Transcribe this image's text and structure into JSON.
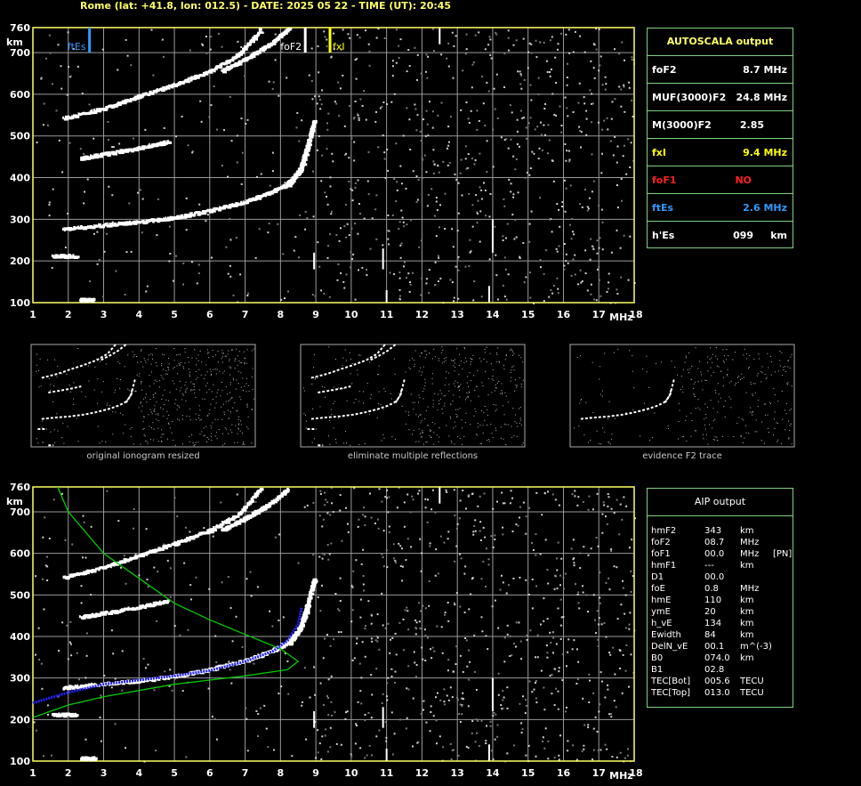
{
  "header": "Rome (lat: +41.8, lon: 012.5) - DATE: 2025 05 22 - TIME (UT): 20:45",
  "colors": {
    "grid": "#9a9a9a",
    "frame": "#ffff66",
    "box": "#7fd07f",
    "ftEs": "#3399ff",
    "foF2": "#ffffff",
    "fxI": "#ffff00",
    "noColor": "#ff2020",
    "trace": "#ffffff",
    "model": "#00cc00",
    "profile": "#2222ff"
  },
  "chart_data": [
    {
      "type": "scatter",
      "name_in_ui": "autoscala-ionogram",
      "x_min": 1,
      "x_max": 18,
      "y_min": 100,
      "y_max": 760,
      "xticks": [
        "1",
        "2",
        "3",
        "4",
        "5",
        "6",
        "7",
        "8",
        "9",
        "10",
        "11",
        "12",
        "13",
        "14",
        "15",
        "16",
        "17",
        "18"
      ],
      "yticks": [
        "100",
        "200",
        "300",
        "400",
        "500",
        "600",
        "700",
        "760"
      ],
      "xunit": "MHz",
      "yunit": "km",
      "markers": [
        {
          "label": "ftEs",
          "freq": 2.6,
          "color": "#3399ff"
        },
        {
          "label": "foF2",
          "freq": 8.7,
          "color": "#ffffff"
        },
        {
          "label": "fxI",
          "freq": 9.4,
          "color": "#ffff00"
        }
      ],
      "traces": [
        {
          "points": [
            [
              1.8,
              280
            ],
            [
              3,
              290
            ],
            [
              4,
              297
            ],
            [
              5,
              308
            ],
            [
              6,
              325
            ],
            [
              7,
              347
            ],
            [
              7.6,
              365
            ],
            [
              8.1,
              385
            ],
            [
              8.5,
              420
            ],
            [
              8.7,
              480
            ]
          ]
        },
        {
          "points": [
            [
              8.2,
              385
            ],
            [
              8.6,
              440
            ],
            [
              8.8,
              510
            ],
            [
              8.9,
              540
            ]
          ]
        },
        {
          "points": [
            [
              1.8,
              545
            ],
            [
              3,
              570
            ],
            [
              4,
              600
            ],
            [
              5,
              628
            ],
            [
              6,
              660
            ],
            [
              6.8,
              700
            ],
            [
              7.4,
              760
            ]
          ]
        },
        {
          "points": [
            [
              6.3,
              660
            ],
            [
              7,
              690
            ],
            [
              7.6,
              720
            ],
            [
              8.2,
              760
            ]
          ]
        },
        {
          "points": [
            [
              2.3,
              450
            ],
            [
              3,
              460
            ],
            [
              4,
              475
            ],
            [
              4.8,
              490
            ]
          ]
        },
        {
          "points": [
            [
              2.3,
              110
            ],
            [
              2.7,
              110
            ]
          ]
        },
        {
          "points": [
            [
              1.5,
              215
            ],
            [
              2.2,
              215
            ]
          ]
        }
      ]
    },
    {
      "type": "scatter",
      "name_in_ui": "aip-ionogram",
      "x_min": 1,
      "x_max": 18,
      "y_min": 100,
      "y_max": 760,
      "xticks": [
        "1",
        "2",
        "3",
        "4",
        "5",
        "6",
        "7",
        "8",
        "9",
        "10",
        "11",
        "12",
        "13",
        "14",
        "15",
        "16",
        "17",
        "18"
      ],
      "yticks": [
        "100",
        "200",
        "300",
        "400",
        "500",
        "600",
        "700",
        "760"
      ],
      "xunit": "MHz",
      "yunit": "km",
      "model_curve": [
        [
          1.7,
          760
        ],
        [
          2,
          700
        ],
        [
          3,
          600
        ],
        [
          4,
          540
        ],
        [
          5,
          480
        ],
        [
          6,
          440
        ],
        [
          7,
          405
        ],
        [
          8,
          370
        ],
        [
          8.5,
          340
        ],
        [
          8.2,
          320
        ],
        [
          7,
          305
        ],
        [
          6,
          295
        ],
        [
          5,
          285
        ],
        [
          4,
          270
        ],
        [
          3,
          255
        ],
        [
          2,
          235
        ],
        [
          1,
          205
        ]
      ],
      "profile_curve": [
        [
          1,
          240
        ],
        [
          2,
          265
        ],
        [
          3,
          285
        ],
        [
          4,
          295
        ],
        [
          5,
          305
        ],
        [
          6,
          318
        ],
        [
          7,
          340
        ],
        [
          7.8,
          365
        ],
        [
          8.2,
          390
        ],
        [
          8.5,
          430
        ],
        [
          8.6,
          470
        ]
      ]
    }
  ],
  "autoscala": {
    "title": "AUTOSCALA output",
    "rows": [
      {
        "label": "foF2",
        "value": "8.7 MHz",
        "color": "#ffffff"
      },
      {
        "label": "MUF(3000)F2",
        "value": "24.8 MHz",
        "color": "#ffffff"
      },
      {
        "label": "M(3000)F2",
        "value": "2.85",
        "color": "#ffffff"
      },
      {
        "label": "fxI",
        "value": "9.4 MHz",
        "color": "#ffff00"
      },
      {
        "label": "foF1",
        "value": "NO",
        "color": "#ff2020"
      },
      {
        "label": "ftEs",
        "value": "2.6 MHz",
        "color": "#3399ff"
      },
      {
        "label": "h'Es",
        "value": "099     km",
        "color": "#ffffff"
      }
    ]
  },
  "aip": {
    "title": "AIP output",
    "rows": [
      {
        "p": "hmF2",
        "v": "343",
        "u": "km",
        "x": ""
      },
      {
        "p": "foF2",
        "v": "08.7",
        "u": "MHz",
        "x": ""
      },
      {
        "p": "foF1",
        "v": "00.0",
        "u": "MHz",
        "x": "[PN]"
      },
      {
        "p": "hmF1",
        "v": "---",
        "u": "km",
        "x": ""
      },
      {
        "p": "D1",
        "v": "00.0",
        "u": "",
        "x": ""
      },
      {
        "p": "foE",
        "v": "0.8",
        "u": "MHz",
        "x": ""
      },
      {
        "p": "hmE",
        "v": "110",
        "u": "km",
        "x": ""
      },
      {
        "p": "ymE",
        "v": "20",
        "u": "km",
        "x": ""
      },
      {
        "p": "h_vE",
        "v": "134",
        "u": "km",
        "x": ""
      },
      {
        "p": "Ewidth",
        "v": "84",
        "u": "km",
        "x": ""
      },
      {
        "p": "DelN_vE",
        "v": "00.1",
        "u": "m^(-3)",
        "x": ""
      },
      {
        "p": "B0",
        "v": "074.0",
        "u": "km",
        "x": ""
      },
      {
        "p": "B1",
        "v": "02.8",
        "u": "",
        "x": ""
      },
      {
        "p": "TEC[Bot]",
        "v": "005.6",
        "u": "TECU",
        "x": ""
      },
      {
        "p": "TEC[Top]",
        "v": "013.0",
        "u": "TECU",
        "x": ""
      }
    ]
  },
  "thumbnails": [
    {
      "caption": "original ionogram resized"
    },
    {
      "caption": "eliminate multiple reflections"
    },
    {
      "caption": "evidence F2 trace"
    }
  ]
}
